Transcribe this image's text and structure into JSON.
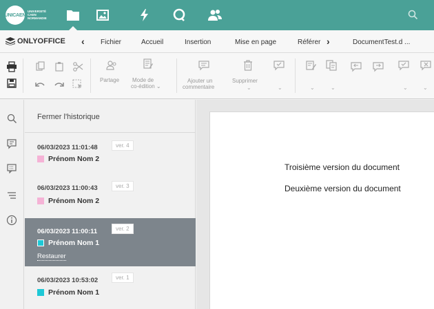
{
  "header": {
    "logo": {
      "short": "UNICAEN",
      "long": "UNIVERSITÉ CAEN NORMANDIE"
    },
    "icons": [
      "folder-icon",
      "image-icon",
      "lightning-icon",
      "chat-icon",
      "users-icon",
      "search-icon"
    ],
    "accent_color": "#4aa197"
  },
  "tabbar": {
    "brand": "ONLYOFFICE",
    "tabs": [
      "Fichier",
      "Accueil",
      "Insertion",
      "Mise en page",
      "Référer"
    ],
    "document_title": "DocumentTest.d ..."
  },
  "toolbar": {
    "share_label": "Partage",
    "coedit_label_line1": "Mode de",
    "coedit_label_line2": "co-édition",
    "add_comment_line1": "Ajouter un",
    "add_comment_line2": "commentaire",
    "delete_label": "Supprimer"
  },
  "history": {
    "close_label": "Fermer l'historique",
    "restore_label": "Restaurer",
    "versions": [
      {
        "date": "06/03/2023 11:01:48",
        "ver": "ver. 4",
        "user": "Prénom Nom 2",
        "color": "#f5b3d6"
      },
      {
        "date": "06/03/2023 11:00:43",
        "ver": "ver. 3",
        "user": "Prénom Nom 2",
        "color": "#f5b3d6"
      },
      {
        "date": "06/03/2023 11:00:11",
        "ver": "ver. 2",
        "user": "Prénom Nom 1",
        "color": "#1ec8d6"
      },
      {
        "date": "06/03/2023 10:53:02",
        "ver": "ver. 1",
        "user": "Prénom Nom 1",
        "color": "#1ec8d6"
      }
    ]
  },
  "document": {
    "lines": [
      "Troisième version du document",
      "Deuxième version du document"
    ]
  }
}
